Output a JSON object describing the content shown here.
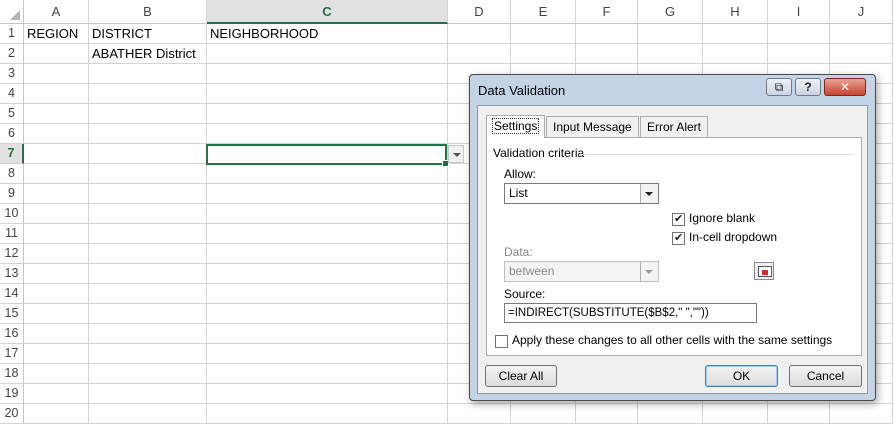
{
  "sheet": {
    "columns": [
      "A",
      "B",
      "C",
      "D",
      "E",
      "F",
      "G",
      "H",
      "I",
      "J"
    ],
    "rows": [
      "1",
      "2",
      "3",
      "4",
      "5",
      "6",
      "7",
      "8",
      "9",
      "10",
      "11",
      "12",
      "13",
      "14",
      "15",
      "16",
      "17",
      "18",
      "19",
      "20"
    ],
    "cells": {
      "A1": "REGION",
      "B1": "DISTRICT",
      "C1": "NEIGHBORHOOD",
      "B2": "ABATHER  District"
    },
    "active_cell": "C7",
    "active_column": "C",
    "active_row": "7",
    "accent_color": "#217346"
  },
  "dialog": {
    "title": "Data Validation",
    "title_buttons": {
      "restore": "⧉",
      "help": "?",
      "close": "✕"
    },
    "tabs": [
      {
        "label": "Settings",
        "selected": true
      },
      {
        "label": "Input Message",
        "selected": false
      },
      {
        "label": "Error Alert",
        "selected": false
      }
    ],
    "criteria_heading": "Validation criteria",
    "allow_label": "Allow:",
    "allow_value": "List",
    "ignore_blank": {
      "label": "Ignore blank",
      "checked": true
    },
    "in_cell_dropdown": {
      "label": "In-cell dropdown",
      "checked": true
    },
    "data_label": "Data:",
    "data_value": "between",
    "source_label": "Source:",
    "source_value": "=INDIRECT(SUBSTITUTE($B$2,\" \",\"\"))",
    "apply_all": {
      "label": "Apply these changes to all other cells with the same settings",
      "checked": false
    },
    "buttons": {
      "clear_all": "Clear All",
      "ok": "OK",
      "cancel": "Cancel"
    }
  }
}
